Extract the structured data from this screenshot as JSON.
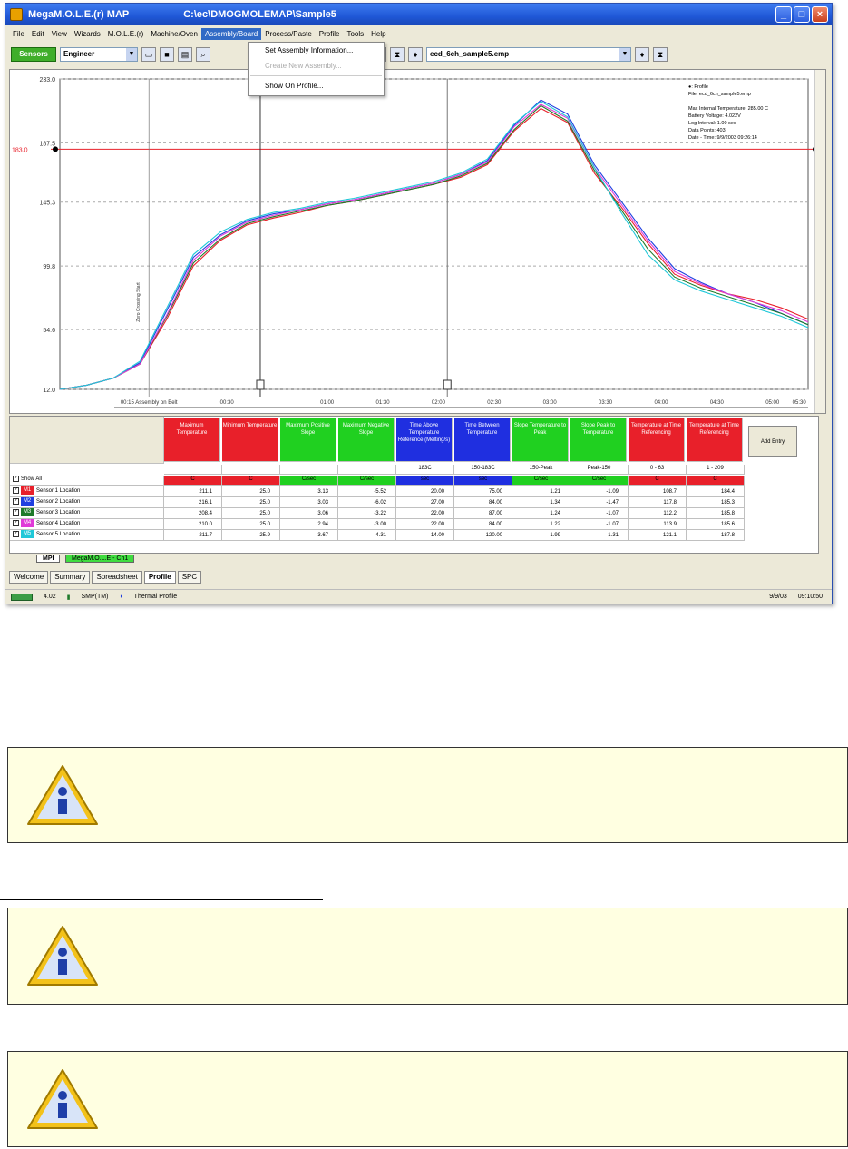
{
  "window": {
    "app_title": "MegaM.O.L.E.(r) MAP",
    "file_path": "C:\\ec\\DMOGMOLEMAP\\Sample5"
  },
  "menu": [
    "File",
    "Edit",
    "View",
    "Wizards",
    "M.O.L.E.(r)",
    "Machine/Oven",
    "Assembly/Board",
    "Process/Paste",
    "Profile",
    "Tools",
    "Help"
  ],
  "menu_active": "Assembly/Board",
  "dropdown": {
    "items": [
      {
        "label": "Set Assembly Information...",
        "enabled": true
      },
      {
        "label": "Create New Assembly...",
        "enabled": false
      },
      {
        "label": "Show On Profile...",
        "enabled": true
      }
    ]
  },
  "toolbar": {
    "green_button": "Sensors",
    "profile_select": "Engineer",
    "file_select": "ecd_6ch_sample5.emp"
  },
  "chart_data": {
    "type": "line",
    "title": "",
    "ylim": [
      12.0,
      233.0
    ],
    "ytick_labels": [
      "233.0",
      "187.5",
      "145.3",
      "99.8",
      "54.6",
      "12.0"
    ],
    "limit_line": {
      "label": "183.0",
      "value": 183.0
    },
    "xtick_labels": [
      "00:15 Assembly on Belt",
      "00:30",
      "01:00",
      "01:30",
      "02:00",
      "02:30",
      "03:00",
      "03:30",
      "04:00",
      "04:30",
      "05:00",
      "05:30"
    ],
    "info": [
      "●: Profile",
      "File: ecd_6ch_sample5.emp",
      "",
      "Max Internal Temperature: 285.00 C",
      "Battery Voltage: 4.022V",
      "Log Interval: 1.00 sec",
      "Data Points: 403",
      "Date - Time: 9/9/2003 09:26:14"
    ],
    "vertical_marker_label": "Zero Crossing Start",
    "series": [
      {
        "name": "Sensor 1",
        "color": "#e8202a",
        "x": [
          0,
          12,
          24,
          36,
          48,
          60,
          72,
          84,
          96,
          108,
          120,
          132,
          144,
          156,
          168,
          180,
          192,
          204,
          216,
          228,
          240,
          252,
          264,
          276,
          288,
          300,
          312,
          324,
          336
        ],
        "y": [
          12,
          15,
          20,
          30,
          62,
          100,
          118,
          129,
          134,
          138,
          143,
          146,
          150,
          154,
          158,
          163,
          172,
          196,
          212,
          202,
          166,
          142,
          116,
          94,
          86,
          80,
          76,
          70,
          62
        ]
      },
      {
        "name": "Sensor 2",
        "color": "#1f3fe0",
        "x": [
          0,
          12,
          24,
          36,
          48,
          60,
          72,
          84,
          96,
          108,
          120,
          132,
          144,
          156,
          168,
          180,
          192,
          204,
          216,
          228,
          240,
          252,
          264,
          276,
          288,
          300,
          312,
          324,
          336
        ],
        "y": [
          12,
          15,
          20,
          31,
          68,
          106,
          122,
          132,
          137,
          140,
          144,
          147,
          151,
          155,
          159,
          165,
          175,
          200,
          218,
          208,
          172,
          146,
          120,
          98,
          88,
          80,
          74,
          66,
          58
        ]
      },
      {
        "name": "Sensor 3",
        "color": "#1e7a2a",
        "x": [
          0,
          12,
          24,
          36,
          48,
          60,
          72,
          84,
          96,
          108,
          120,
          132,
          144,
          156,
          168,
          180,
          192,
          204,
          216,
          228,
          240,
          252,
          264,
          276,
          288,
          300,
          312,
          324,
          336
        ],
        "y": [
          12,
          15,
          20,
          30,
          64,
          102,
          119,
          130,
          135,
          139,
          143,
          146,
          150,
          154,
          158,
          164,
          173,
          197,
          214,
          203,
          168,
          140,
          112,
          92,
          84,
          78,
          72,
          66,
          58
        ]
      },
      {
        "name": "Sensor 4",
        "color": "#e03ad8",
        "x": [
          0,
          12,
          24,
          36,
          48,
          60,
          72,
          84,
          96,
          108,
          120,
          132,
          144,
          156,
          168,
          180,
          192,
          204,
          216,
          228,
          240,
          252,
          264,
          276,
          288,
          300,
          312,
          324,
          336
        ],
        "y": [
          12,
          15,
          20,
          30,
          65,
          104,
          121,
          131,
          136,
          140,
          144,
          147,
          151,
          155,
          159,
          165,
          174,
          199,
          215,
          205,
          170,
          144,
          118,
          96,
          87,
          80,
          74,
          68,
          60
        ]
      },
      {
        "name": "Sensor 5",
        "color": "#20c8d8",
        "x": [
          0,
          12,
          24,
          36,
          48,
          60,
          72,
          84,
          96,
          108,
          120,
          132,
          144,
          156,
          168,
          180,
          192,
          204,
          216,
          228,
          240,
          252,
          264,
          276,
          288,
          300,
          312,
          324,
          336
        ],
        "y": [
          12,
          15,
          20,
          32,
          70,
          108,
          124,
          133,
          138,
          141,
          145,
          148,
          152,
          156,
          160,
          166,
          176,
          201,
          217,
          206,
          170,
          138,
          108,
          90,
          82,
          76,
          70,
          64,
          56
        ]
      }
    ]
  },
  "grid": {
    "headers": [
      {
        "label": "Maximum Temperature",
        "color": "#e8202a"
      },
      {
        "label": "Minimum Temperature",
        "color": "#e8202a"
      },
      {
        "label": "Maximum Positive Slope",
        "color": "#20d020"
      },
      {
        "label": "Maximum Negative Slope",
        "color": "#20d020"
      },
      {
        "label": "Time Above Temperature Reference (Melting/s)",
        "color": "#1f2fe0"
      },
      {
        "label": "Time Between Temperature",
        "color": "#1f2fe0"
      },
      {
        "label": "Slope Temperature to Peak",
        "color": "#20d020"
      },
      {
        "label": "Slope Peak to Temperature",
        "color": "#20d020"
      },
      {
        "label": "Temperature at Time Referencing",
        "color": "#e8202a"
      },
      {
        "label": "Temperature at Time Referencing",
        "color": "#e8202a"
      }
    ],
    "add_button": "Add Entry",
    "param_row": [
      "",
      "",
      "",
      "",
      "183C",
      "150-183C",
      "150-Peak",
      "Peak-150",
      "0 - 63",
      "1 - 209"
    ],
    "status_row": [
      {
        "text": "C",
        "color": "#e8202a"
      },
      {
        "text": "C",
        "color": "#e8202a"
      },
      {
        "text": "C/sec",
        "color": "#20d020"
      },
      {
        "text": "C/sec",
        "color": "#20d020"
      },
      {
        "text": "sec",
        "color": "#1f2fe0"
      },
      {
        "text": "sec",
        "color": "#1f2fe0"
      },
      {
        "text": "C/sec",
        "color": "#20d020"
      },
      {
        "text": "C/sec",
        "color": "#20d020"
      },
      {
        "text": "C",
        "color": "#e8202a"
      },
      {
        "text": "C",
        "color": "#e8202a"
      }
    ],
    "show_all": "Show All",
    "rows": [
      {
        "tag": "M1",
        "color": "#e8202a",
        "label": "Sensor 1 Location",
        "values": [
          "211.1",
          "25.0",
          "3.13",
          "-5.52",
          "20.00",
          "75.00",
          "1.21",
          "-1.09",
          "108.7",
          "184.4"
        ]
      },
      {
        "tag": "M2",
        "color": "#1f3fe0",
        "label": "Sensor 2 Location",
        "values": [
          "216.1",
          "25.0",
          "3.03",
          "-6.02",
          "27.00",
          "84.00",
          "1.34",
          "-1.47",
          "117.8",
          "185.3"
        ]
      },
      {
        "tag": "M3",
        "color": "#1e7a2a",
        "label": "Sensor 3 Location",
        "values": [
          "208.4",
          "25.0",
          "3.06",
          "-3.22",
          "22.00",
          "87.00",
          "1.24",
          "-1.07",
          "112.2",
          "185.8"
        ]
      },
      {
        "tag": "M4",
        "color": "#e03ad8",
        "label": "Sensor 4 Location",
        "values": [
          "210.0",
          "25.0",
          "2.94",
          "-3.00",
          "22.00",
          "84.00",
          "1.22",
          "-1.07",
          "113.9",
          "185.6"
        ]
      },
      {
        "tag": "M5",
        "color": "#20c8d8",
        "label": "Sensor 5 Location",
        "values": [
          "211.7",
          "25.9",
          "3.67",
          "-4.31",
          "14.00",
          "120.00",
          "1.99",
          "-1.31",
          "121.1",
          "187.8"
        ]
      }
    ]
  },
  "sheet_tabs": [
    "MPI",
    "MegaM.O.L.E - Ch1"
  ],
  "view_tabs": [
    "Welcome",
    "Summary",
    "Spreadsheet",
    "Profile",
    "SPC"
  ],
  "view_tab_active": "Profile",
  "status": {
    "battery": "4.02",
    "sensors": "SMP(TM)",
    "mode": "Thermal Profile",
    "right1": "9/9/03",
    "right2": "09:10:50"
  }
}
